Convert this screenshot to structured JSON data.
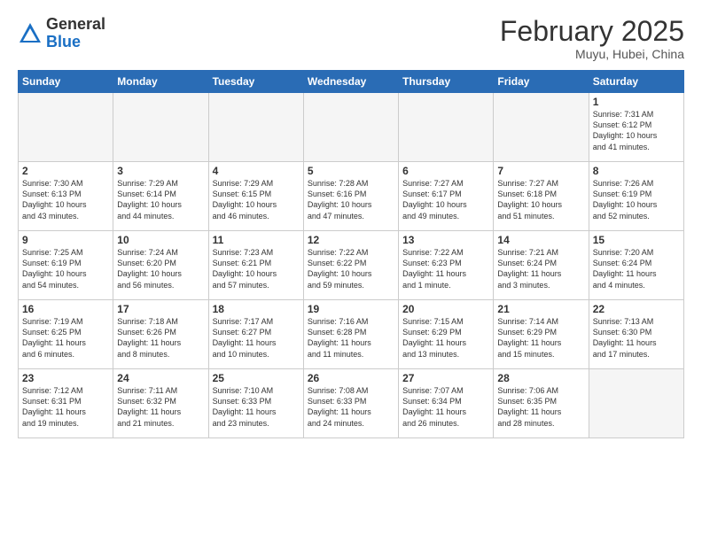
{
  "header": {
    "logo_general": "General",
    "logo_blue": "Blue",
    "month_title": "February 2025",
    "location": "Muyu, Hubei, China"
  },
  "weekdays": [
    "Sunday",
    "Monday",
    "Tuesday",
    "Wednesday",
    "Thursday",
    "Friday",
    "Saturday"
  ],
  "weeks": [
    [
      {
        "day": "",
        "info": ""
      },
      {
        "day": "",
        "info": ""
      },
      {
        "day": "",
        "info": ""
      },
      {
        "day": "",
        "info": ""
      },
      {
        "day": "",
        "info": ""
      },
      {
        "day": "",
        "info": ""
      },
      {
        "day": "1",
        "info": "Sunrise: 7:31 AM\nSunset: 6:12 PM\nDaylight: 10 hours\nand 41 minutes."
      }
    ],
    [
      {
        "day": "2",
        "info": "Sunrise: 7:30 AM\nSunset: 6:13 PM\nDaylight: 10 hours\nand 43 minutes."
      },
      {
        "day": "3",
        "info": "Sunrise: 7:29 AM\nSunset: 6:14 PM\nDaylight: 10 hours\nand 44 minutes."
      },
      {
        "day": "4",
        "info": "Sunrise: 7:29 AM\nSunset: 6:15 PM\nDaylight: 10 hours\nand 46 minutes."
      },
      {
        "day": "5",
        "info": "Sunrise: 7:28 AM\nSunset: 6:16 PM\nDaylight: 10 hours\nand 47 minutes."
      },
      {
        "day": "6",
        "info": "Sunrise: 7:27 AM\nSunset: 6:17 PM\nDaylight: 10 hours\nand 49 minutes."
      },
      {
        "day": "7",
        "info": "Sunrise: 7:27 AM\nSunset: 6:18 PM\nDaylight: 10 hours\nand 51 minutes."
      },
      {
        "day": "8",
        "info": "Sunrise: 7:26 AM\nSunset: 6:19 PM\nDaylight: 10 hours\nand 52 minutes."
      }
    ],
    [
      {
        "day": "9",
        "info": "Sunrise: 7:25 AM\nSunset: 6:19 PM\nDaylight: 10 hours\nand 54 minutes."
      },
      {
        "day": "10",
        "info": "Sunrise: 7:24 AM\nSunset: 6:20 PM\nDaylight: 10 hours\nand 56 minutes."
      },
      {
        "day": "11",
        "info": "Sunrise: 7:23 AM\nSunset: 6:21 PM\nDaylight: 10 hours\nand 57 minutes."
      },
      {
        "day": "12",
        "info": "Sunrise: 7:22 AM\nSunset: 6:22 PM\nDaylight: 10 hours\nand 59 minutes."
      },
      {
        "day": "13",
        "info": "Sunrise: 7:22 AM\nSunset: 6:23 PM\nDaylight: 11 hours\nand 1 minute."
      },
      {
        "day": "14",
        "info": "Sunrise: 7:21 AM\nSunset: 6:24 PM\nDaylight: 11 hours\nand 3 minutes."
      },
      {
        "day": "15",
        "info": "Sunrise: 7:20 AM\nSunset: 6:24 PM\nDaylight: 11 hours\nand 4 minutes."
      }
    ],
    [
      {
        "day": "16",
        "info": "Sunrise: 7:19 AM\nSunset: 6:25 PM\nDaylight: 11 hours\nand 6 minutes."
      },
      {
        "day": "17",
        "info": "Sunrise: 7:18 AM\nSunset: 6:26 PM\nDaylight: 11 hours\nand 8 minutes."
      },
      {
        "day": "18",
        "info": "Sunrise: 7:17 AM\nSunset: 6:27 PM\nDaylight: 11 hours\nand 10 minutes."
      },
      {
        "day": "19",
        "info": "Sunrise: 7:16 AM\nSunset: 6:28 PM\nDaylight: 11 hours\nand 11 minutes."
      },
      {
        "day": "20",
        "info": "Sunrise: 7:15 AM\nSunset: 6:29 PM\nDaylight: 11 hours\nand 13 minutes."
      },
      {
        "day": "21",
        "info": "Sunrise: 7:14 AM\nSunset: 6:29 PM\nDaylight: 11 hours\nand 15 minutes."
      },
      {
        "day": "22",
        "info": "Sunrise: 7:13 AM\nSunset: 6:30 PM\nDaylight: 11 hours\nand 17 minutes."
      }
    ],
    [
      {
        "day": "23",
        "info": "Sunrise: 7:12 AM\nSunset: 6:31 PM\nDaylight: 11 hours\nand 19 minutes."
      },
      {
        "day": "24",
        "info": "Sunrise: 7:11 AM\nSunset: 6:32 PM\nDaylight: 11 hours\nand 21 minutes."
      },
      {
        "day": "25",
        "info": "Sunrise: 7:10 AM\nSunset: 6:33 PM\nDaylight: 11 hours\nand 23 minutes."
      },
      {
        "day": "26",
        "info": "Sunrise: 7:08 AM\nSunset: 6:33 PM\nDaylight: 11 hours\nand 24 minutes."
      },
      {
        "day": "27",
        "info": "Sunrise: 7:07 AM\nSunset: 6:34 PM\nDaylight: 11 hours\nand 26 minutes."
      },
      {
        "day": "28",
        "info": "Sunrise: 7:06 AM\nSunset: 6:35 PM\nDaylight: 11 hours\nand 28 minutes."
      },
      {
        "day": "",
        "info": ""
      }
    ]
  ]
}
